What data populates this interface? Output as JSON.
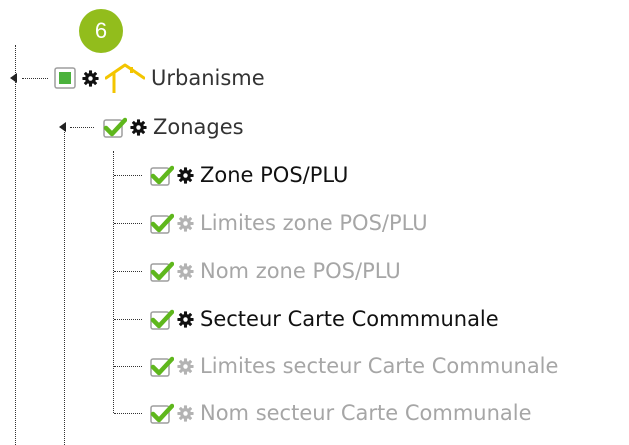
{
  "step_badge": "6",
  "colors": {
    "badge": "#92bd1c",
    "checkbox_green": "#5fb71d",
    "text_active": "#111111",
    "text_disabled": "#a6a6a6"
  },
  "tree": {
    "root": {
      "label": "Urbanisme",
      "state": "partial",
      "icon": "house-icon"
    },
    "group": {
      "label": "Zonages",
      "state": "checked"
    },
    "layers": [
      {
        "label": "Zone POS/PLU",
        "checked": true,
        "active": true
      },
      {
        "label": "Limites zone POS/PLU",
        "checked": true,
        "active": false
      },
      {
        "label": "Nom zone POS/PLU",
        "checked": true,
        "active": false
      },
      {
        "label": "Secteur Carte Commmunale",
        "checked": true,
        "active": true
      },
      {
        "label": "Limites secteur Carte Communale",
        "checked": true,
        "active": false
      },
      {
        "label": "Nom secteur Carte Communale",
        "checked": true,
        "active": false
      }
    ]
  }
}
